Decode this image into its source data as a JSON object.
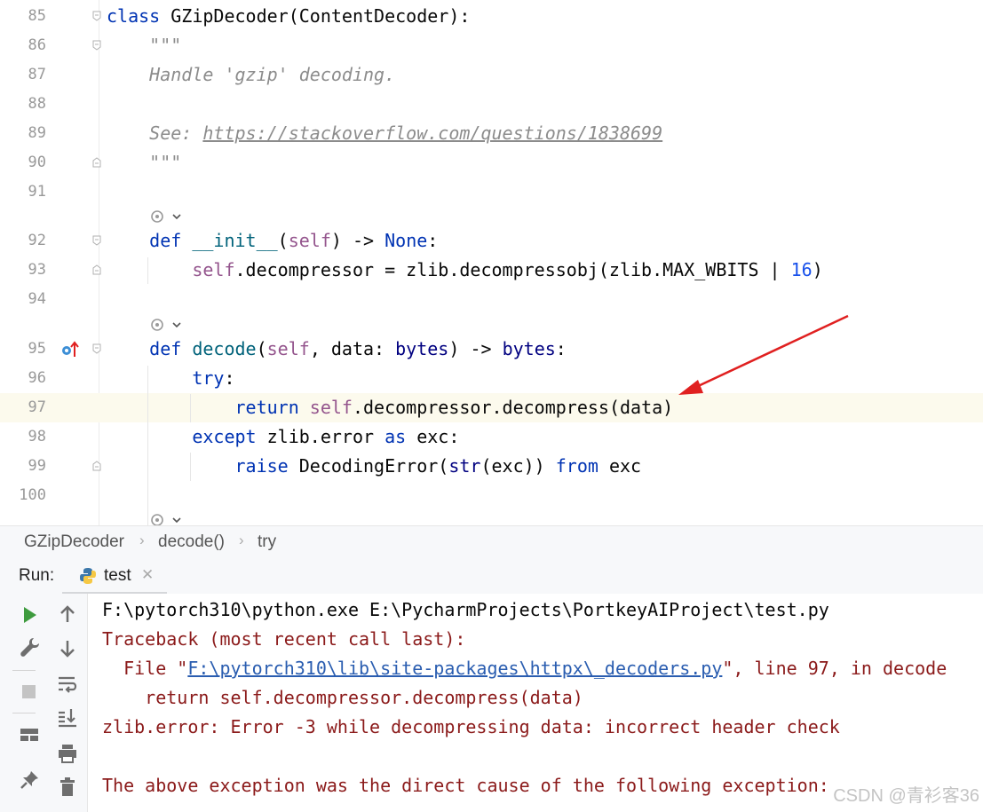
{
  "editor": {
    "lines": [
      {
        "n": "85",
        "seg": [
          [
            "kw",
            "class "
          ],
          [
            "",
            "GZipDecoder(ContentDecoder):"
          ]
        ]
      },
      {
        "n": "86",
        "seg": [
          [
            "doc",
            "    \"\"\""
          ]
        ]
      },
      {
        "n": "87",
        "seg": [
          [
            "doc",
            "    Handle 'gzip' decoding."
          ]
        ]
      },
      {
        "n": "88",
        "seg": []
      },
      {
        "n": "89",
        "seg": [
          [
            "doc",
            "    See: "
          ],
          [
            "lnk",
            "https://stackoverflow.com/questions/1838699"
          ]
        ]
      },
      {
        "n": "90",
        "seg": [
          [
            "doc",
            "    \"\"\""
          ]
        ]
      },
      {
        "n": "91",
        "seg": []
      },
      {
        "n": "92",
        "seg": [
          [
            "",
            "    "
          ],
          [
            "kw",
            "def "
          ],
          [
            "dfn",
            "__init__"
          ],
          [
            "",
            "("
          ],
          [
            "slf",
            "self"
          ],
          [
            "",
            " ) -> "
          ],
          [
            "kw",
            "None"
          ],
          [
            "",
            ":"
          ]
        ]
      },
      {
        "n": "93",
        "seg": [
          [
            "",
            "        "
          ],
          [
            "slf",
            "self"
          ],
          [
            "",
            ".decompressor = zlib.decompressobj(zlib.MAX_WBITS | "
          ],
          [
            "num",
            "16"
          ],
          [
            "",
            ")"
          ]
        ]
      },
      {
        "n": "94",
        "seg": []
      },
      {
        "n": "95",
        "seg": [
          [
            "",
            "    "
          ],
          [
            "kw",
            "def "
          ],
          [
            "dfn",
            "decode"
          ],
          [
            "",
            "("
          ],
          [
            "slf",
            "self"
          ],
          [
            "",
            ", data: "
          ],
          [
            "bi",
            "bytes"
          ],
          [
            "",
            " ) -> "
          ],
          [
            "bi",
            "bytes"
          ],
          [
            "",
            ":"
          ]
        ]
      },
      {
        "n": "96",
        "seg": [
          [
            "",
            "        "
          ],
          [
            "kw",
            "try"
          ],
          [
            "",
            ":"
          ]
        ]
      },
      {
        "n": "97",
        "seg": [
          [
            "",
            "            "
          ],
          [
            "kw",
            "return "
          ],
          [
            "slf",
            "self"
          ],
          [
            "",
            ".decompressor.decompress(data)"
          ]
        ]
      },
      {
        "n": "98",
        "seg": [
          [
            "",
            "        "
          ],
          [
            "kw",
            "except "
          ],
          [
            "",
            "zlib.error "
          ],
          [
            "kw",
            "as "
          ],
          [
            "",
            "exc:"
          ]
        ]
      },
      {
        "n": "99",
        "seg": [
          [
            "",
            "            "
          ],
          [
            "kw",
            "raise "
          ],
          [
            "",
            "DecodingError("
          ],
          [
            "bi",
            "str"
          ],
          [
            "",
            "(exc)) "
          ],
          [
            "kw",
            "from "
          ],
          [
            "",
            "exc"
          ]
        ]
      },
      {
        "n": "100",
        "seg": []
      }
    ]
  },
  "breadcrumb": {
    "items": [
      "GZipDecoder",
      "decode()",
      "try"
    ]
  },
  "run": {
    "label": "Run:",
    "tab": "test",
    "output": [
      {
        "style": "plain",
        "text": "F:\\pytorch310\\python.exe E:\\PycharmProjects\\PortkeyAIProject\\test.py"
      },
      {
        "style": "err",
        "text": "Traceback (most recent call last):"
      },
      {
        "style": "err",
        "pre": "  File \"",
        "link": "F:\\pytorch310\\lib\\site-packages\\httpx\\_decoders.py",
        "post": "\", line 97, in decode"
      },
      {
        "style": "err",
        "text": "    return self.decompressor.decompress(data)"
      },
      {
        "style": "err",
        "text": "zlib.error: Error -3 while decompressing data: incorrect header check"
      },
      {
        "style": "err",
        "text": ""
      },
      {
        "style": "err",
        "text": "The above exception was the direct cause of the following exception:"
      }
    ]
  },
  "watermark": "CSDN @青衫客36",
  "colors": {
    "keyword": "#0033b3",
    "self": "#94558d",
    "number": "#1750eb",
    "doc": "#8c8c8c",
    "error": "#8b1a1a",
    "link": "#2a5db0",
    "arrow": "#e02020",
    "run_green": "#3e9b3e"
  },
  "icons": [
    "fold-icon",
    "inlay-hint-icon",
    "override-marker-icon",
    "run-icon",
    "wrench-icon",
    "stop-icon",
    "layout-icon",
    "pin-icon",
    "up-arrow-icon",
    "down-arrow-icon",
    "soft-wrap-icon",
    "scroll-to-end-icon",
    "print-icon",
    "trash-icon",
    "python-icon",
    "close-icon"
  ]
}
